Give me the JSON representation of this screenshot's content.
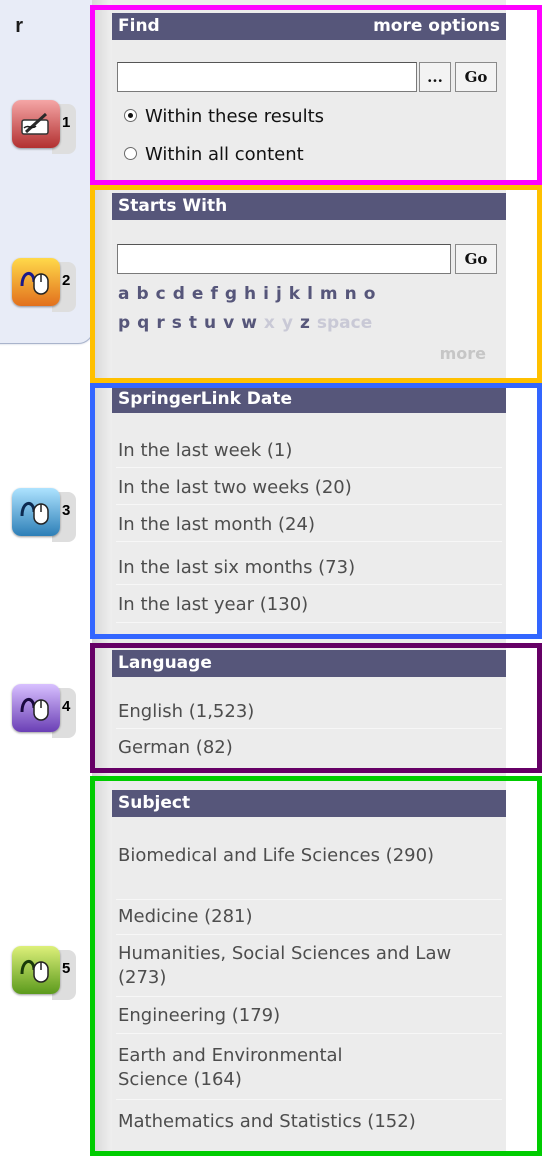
{
  "callout": {
    "text": "r"
  },
  "find": {
    "title": "Find",
    "more_options": "more options",
    "browse_label": "...",
    "go_label": "Go",
    "radio_within_results": "Within these results",
    "radio_within_all": "Within all content",
    "selected": "Within these results"
  },
  "starts_with": {
    "title": "Starts With",
    "go_label": "Go",
    "letters_row1": [
      "a",
      "b",
      "c",
      "d",
      "e",
      "f",
      "g",
      "h",
      "i",
      "j",
      "k",
      "l",
      "m",
      "n",
      "o"
    ],
    "letters_row2_active": [
      "p",
      "q",
      "r",
      "s",
      "t",
      "u",
      "v",
      "w"
    ],
    "letters_row2_dim": [
      "x",
      "y"
    ],
    "letters_row2_active_z": "z",
    "space_label": "space",
    "more_label": "more"
  },
  "date": {
    "title": "SpringerLink Date",
    "items": [
      "In the last week (1)",
      "In the last two weeks (20)",
      "In the last month (24)",
      "In the last six months (73)",
      "In the last year (130)"
    ]
  },
  "language": {
    "title": "Language",
    "items": [
      "English (1,523)",
      "German (82)"
    ]
  },
  "subject": {
    "title": "Subject",
    "items": [
      "Biomedical and Life Sciences (290)",
      "Medicine (281)",
      "Humanities, Social Sciences and Law (273)",
      "Engineering (179)",
      "Earth and Environmental Science (164)",
      "Mathematics and Statistics (152)"
    ]
  },
  "markers": [
    "1",
    "2",
    "3",
    "4",
    "5"
  ],
  "colors": {
    "header_bg": "#56567a",
    "panel_bg": "#ececec",
    "frame_find": "#ff00ff",
    "frame_starts": "#ffc000",
    "frame_date": "#3366ff",
    "frame_language": "#660066",
    "frame_subject": "#00cc00"
  },
  "icons": [
    "pen-tablet-icon",
    "mouse-icon",
    "mouse-icon",
    "mouse-icon",
    "mouse-icon"
  ]
}
